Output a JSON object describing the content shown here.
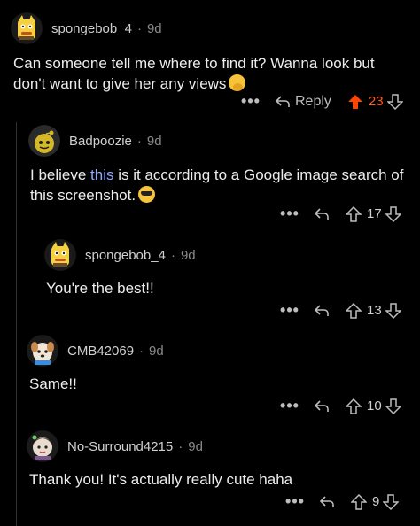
{
  "comments": [
    {
      "user": "spongebob_4",
      "dot": "·",
      "age": "9d",
      "text": "Can someone tell me where to find it? Wanna look but don't want to give her any views",
      "reply_label": "Reply",
      "votes": "23",
      "upvoted": true,
      "emoji": "shushing-face-emoji"
    },
    {
      "user": "Badpoozie",
      "dot": "·",
      "age": "9d",
      "text_before": "I believe ",
      "link_text": "this",
      "text_after": " is it according to a Google image search of this screenshot.",
      "votes": "17",
      "emoji": "sunglasses-face-emoji"
    },
    {
      "user": "spongebob_4",
      "dot": "·",
      "age": "9d",
      "text": "You're the best!!",
      "votes": "13"
    },
    {
      "user": "CMB42069",
      "dot": "·",
      "age": "9d",
      "text": "Same!!",
      "votes": "10"
    },
    {
      "user": "No-Surround4215",
      "dot": "·",
      "age": "9d",
      "text": "Thank you! It's actually really cute haha",
      "votes": "9"
    }
  ],
  "colors": {
    "background": "#000000",
    "upvote_active": "#ff4500",
    "link": "#8fa8ff",
    "muted": "#8a8a8a"
  },
  "icons": {
    "more": "•••",
    "reply": "reply-arrow-icon",
    "upvote": "upvote-arrow-icon",
    "downvote": "downvote-arrow-icon"
  }
}
